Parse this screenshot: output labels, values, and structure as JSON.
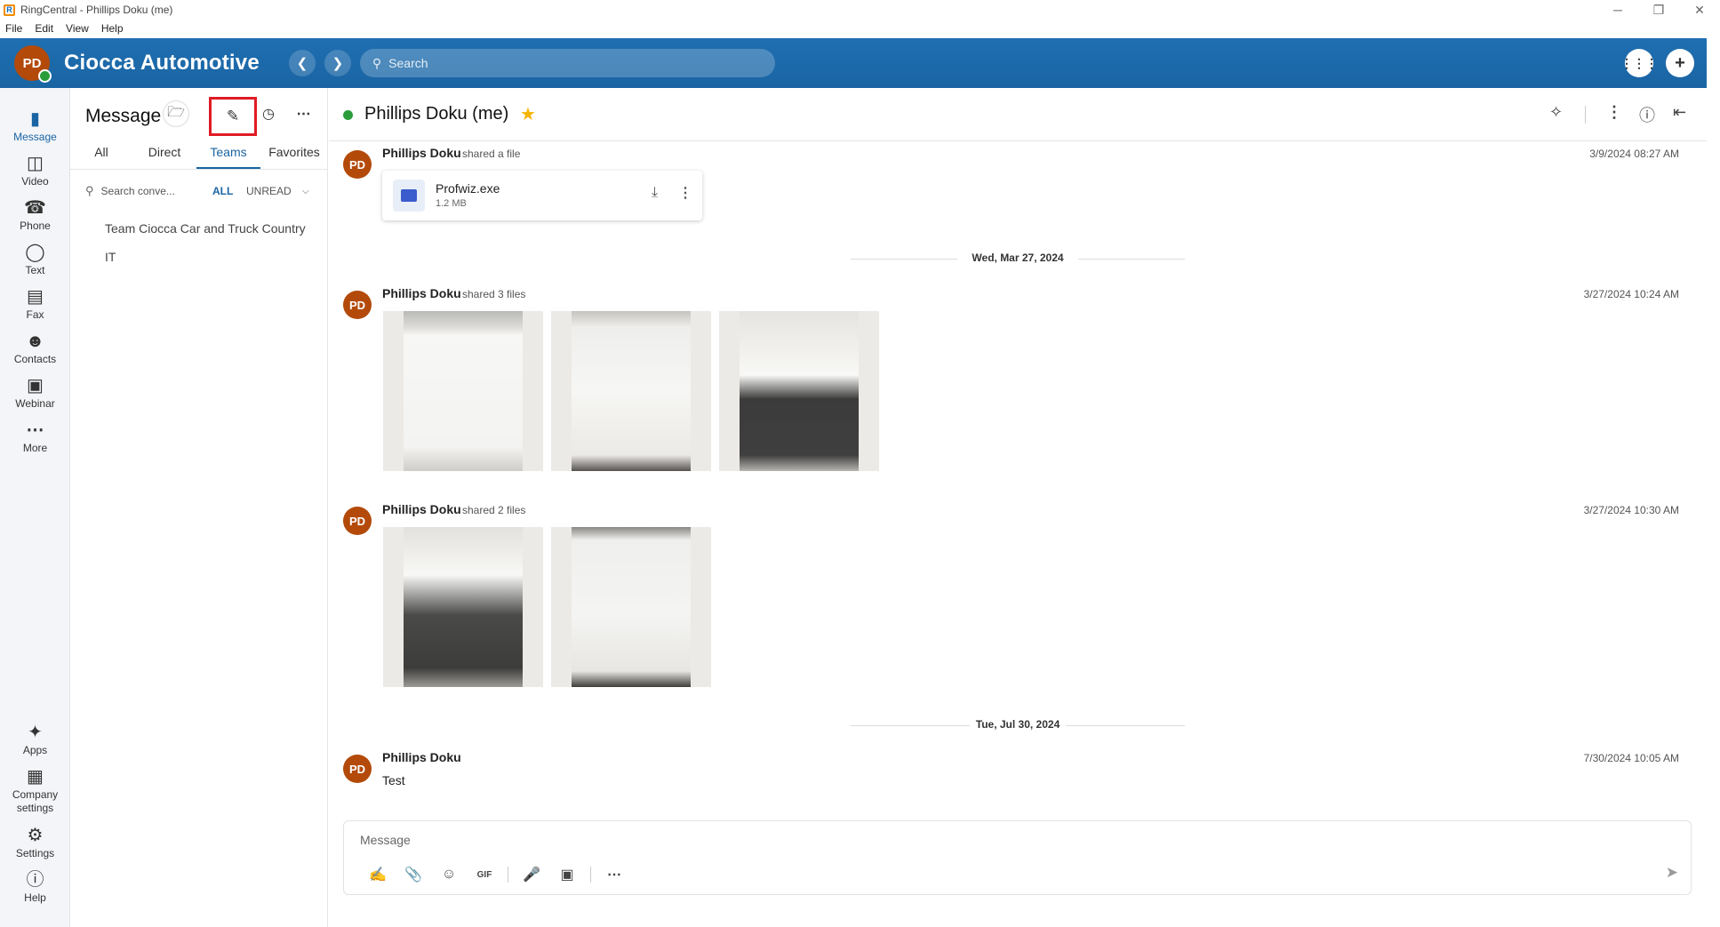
{
  "window": {
    "title": "RingCentral - Phillips Doku (me)",
    "controls": {
      "minimize": "─",
      "restore": "❐",
      "close": "✕"
    }
  },
  "menubar": [
    "File",
    "Edit",
    "View",
    "Help"
  ],
  "topbar": {
    "avatar_initials": "PD",
    "company": "Ciocca Automotive",
    "search_placeholder": "Search",
    "dialpad_icon": "dialpad-icon",
    "add_icon": "plus-icon"
  },
  "leftnav": {
    "items": [
      {
        "label": "Message",
        "icon": "message-icon",
        "active": true
      },
      {
        "label": "Video",
        "icon": "video-icon"
      },
      {
        "label": "Phone",
        "icon": "phone-icon"
      },
      {
        "label": "Text",
        "icon": "text-icon"
      },
      {
        "label": "Fax",
        "icon": "fax-icon"
      },
      {
        "label": "Contacts",
        "icon": "contacts-icon"
      },
      {
        "label": "Webinar",
        "icon": "webinar-icon"
      },
      {
        "label": "More",
        "icon": "more-icon"
      }
    ],
    "bottom": [
      {
        "label": "Apps",
        "icon": "apps-icon"
      },
      {
        "label": "Company settings",
        "icon": "company-settings-icon"
      },
      {
        "label": "Settings",
        "icon": "settings-icon"
      },
      {
        "label": "Help",
        "icon": "help-icon"
      }
    ]
  },
  "conversations": {
    "header": "Message",
    "tabs": [
      "All",
      "Direct",
      "Teams",
      "Favorites"
    ],
    "active_tab": "Teams",
    "search_placeholder": "Search conve...",
    "filter_all": "ALL",
    "filter_unread": "UNREAD",
    "items": [
      "Team Ciocca Car and Truck Country",
      "IT"
    ]
  },
  "chat": {
    "title": "Phillips Doku (me)",
    "messages": [
      {
        "sender": "Phillips Doku",
        "action": "shared a file",
        "time": "3/9/2024 08:27 AM",
        "file": {
          "name": "Profwiz.exe",
          "size": "1.2 MB"
        }
      },
      {
        "day": "Wed, Mar 27, 2024"
      },
      {
        "sender": "Phillips Doku",
        "action": "shared 3 files",
        "time": "3/27/2024 10:24 AM"
      },
      {
        "sender": "Phillips Doku",
        "action": "shared 2 files",
        "time": "3/27/2024 10:30 AM"
      },
      {
        "day": "Tue, Jul 30, 2024"
      },
      {
        "sender": "Phillips Doku",
        "action": "",
        "time": "7/30/2024 10:05 AM",
        "text": "Test"
      }
    ],
    "composer_placeholder": "Message"
  }
}
